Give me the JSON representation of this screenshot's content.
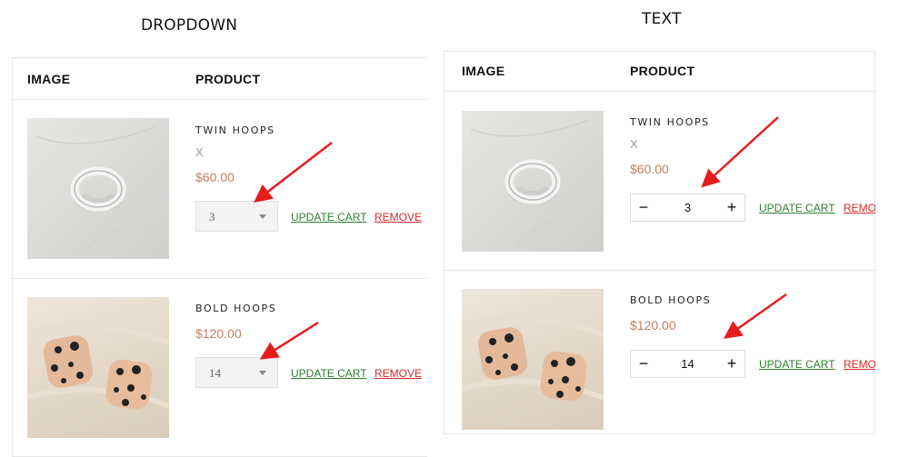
{
  "headings": {
    "left": "DROPDOWN",
    "right": "TEXT"
  },
  "table": {
    "col_image": "IMAGE",
    "col_product": "PRODUCT"
  },
  "products": [
    {
      "name": "TWIN HOOPS",
      "variant": "X",
      "price": "$60.00",
      "quantity": "3"
    },
    {
      "name": "BOLD HOOPS",
      "price": "$120.00",
      "quantity": "14"
    }
  ],
  "actions": {
    "update_cart": "UPDATE CART",
    "remove": "REMOVE",
    "remove_truncated": "REMO"
  },
  "stepper": {
    "minus": "−",
    "plus": "+"
  },
  "colors": {
    "price": "#c17f5f",
    "update_link": "#2e7d2e",
    "remove_link": "#d42a2a",
    "arrow": "#e51c1c"
  },
  "icons": {
    "dropdown_caret": "chevron-down-icon",
    "annotation_arrow": "red-arrow-icon"
  }
}
